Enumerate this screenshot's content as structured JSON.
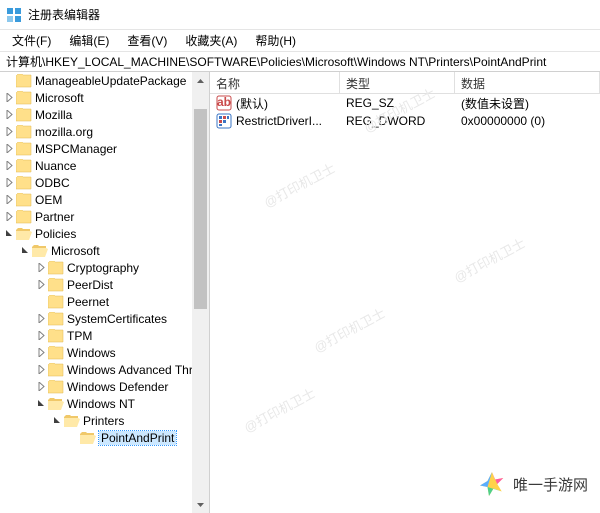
{
  "title": "注册表编辑器",
  "menus": {
    "file": "文件(F)",
    "edit": "编辑(E)",
    "view": "查看(V)",
    "favorites": "收藏夹(A)",
    "help": "帮助(H)"
  },
  "address": "计算机\\HKEY_LOCAL_MACHINE\\SOFTWARE\\Policies\\Microsoft\\Windows NT\\Printers\\PointAndPrint",
  "tree": [
    {
      "label": "ManageableUpdatePackage",
      "indent": 0,
      "exp": "none",
      "sel": false
    },
    {
      "label": "Microsoft",
      "indent": 0,
      "exp": "closed",
      "sel": false
    },
    {
      "label": "Mozilla",
      "indent": 0,
      "exp": "closed",
      "sel": false
    },
    {
      "label": "mozilla.org",
      "indent": 0,
      "exp": "closed",
      "sel": false
    },
    {
      "label": "MSPCManager",
      "indent": 0,
      "exp": "closed",
      "sel": false
    },
    {
      "label": "Nuance",
      "indent": 0,
      "exp": "closed",
      "sel": false
    },
    {
      "label": "ODBC",
      "indent": 0,
      "exp": "closed",
      "sel": false
    },
    {
      "label": "OEM",
      "indent": 0,
      "exp": "closed",
      "sel": false
    },
    {
      "label": "Partner",
      "indent": 0,
      "exp": "closed",
      "sel": false
    },
    {
      "label": "Policies",
      "indent": 0,
      "exp": "open",
      "sel": false
    },
    {
      "label": "Microsoft",
      "indent": 1,
      "exp": "open",
      "sel": false
    },
    {
      "label": "Cryptography",
      "indent": 2,
      "exp": "closed",
      "sel": false
    },
    {
      "label": "PeerDist",
      "indent": 2,
      "exp": "closed",
      "sel": false
    },
    {
      "label": "Peernet",
      "indent": 2,
      "exp": "none",
      "sel": false
    },
    {
      "label": "SystemCertificates",
      "indent": 2,
      "exp": "closed",
      "sel": false
    },
    {
      "label": "TPM",
      "indent": 2,
      "exp": "closed",
      "sel": false
    },
    {
      "label": "Windows",
      "indent": 2,
      "exp": "closed",
      "sel": false
    },
    {
      "label": "Windows Advanced Threat Protection",
      "indent": 2,
      "exp": "closed",
      "sel": false
    },
    {
      "label": "Windows Defender",
      "indent": 2,
      "exp": "closed",
      "sel": false
    },
    {
      "label": "Windows NT",
      "indent": 2,
      "exp": "open",
      "sel": false
    },
    {
      "label": "Printers",
      "indent": 3,
      "exp": "open",
      "sel": false
    },
    {
      "label": "PointAndPrint",
      "indent": 4,
      "exp": "none",
      "sel": true
    }
  ],
  "columns": {
    "name": "名称",
    "type": "类型",
    "data": "数据"
  },
  "values": [
    {
      "icon": "string",
      "name": "(默认)",
      "type": "REG_SZ",
      "data": "(数值未设置)"
    },
    {
      "icon": "dword",
      "name": "RestrictDriverI...",
      "type": "REG_DWORD",
      "data": "0x00000000 (0)"
    }
  ],
  "watermark": "@打印机卫士",
  "logo_text": "唯一手游网"
}
